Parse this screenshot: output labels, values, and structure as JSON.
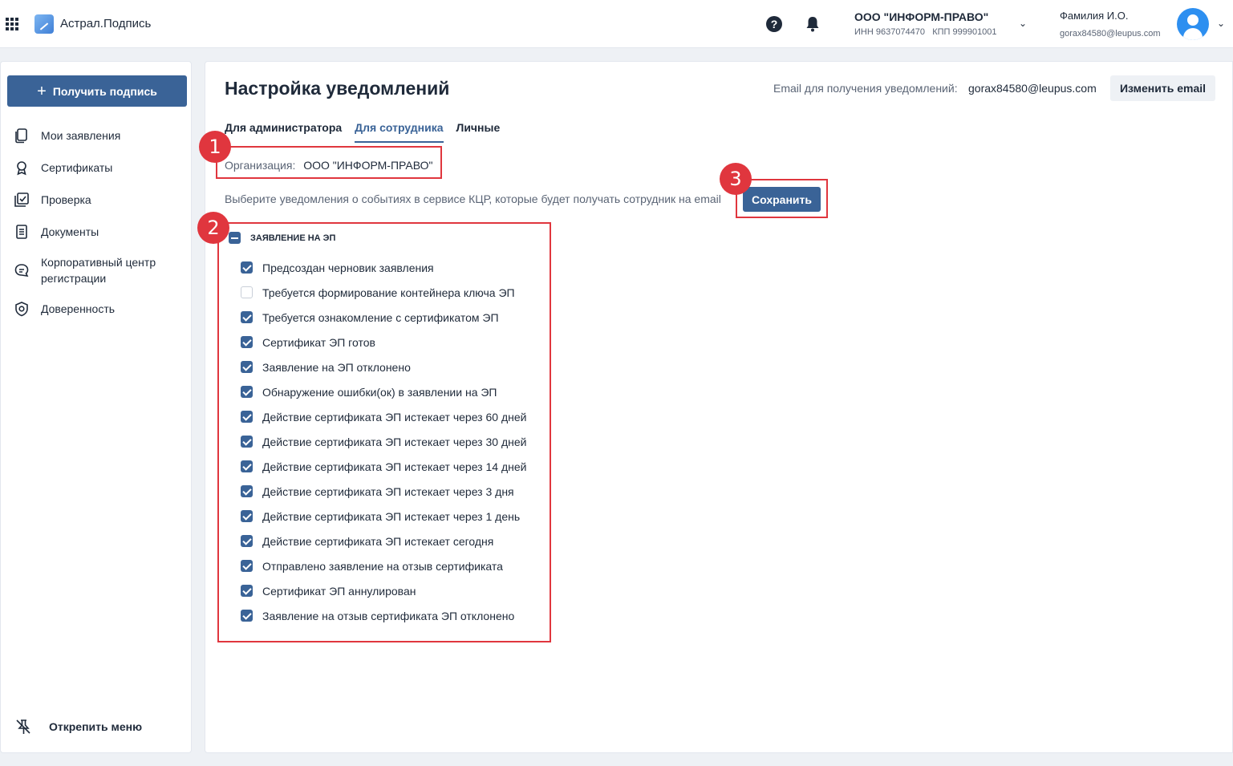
{
  "header": {
    "app_title": "Астрал.Подпись",
    "org_name": "ООО \"ИНФОРМ-ПРАВО\"",
    "org_inn": "ИНН 9637074470",
    "org_kpp": "КПП 999901001",
    "user_name": "Фамилия И.О.",
    "user_email": "gorax84580@leupus.com",
    "icons": [
      "apps-grid-icon",
      "help-icon",
      "bell-icon",
      "chevron-down-icon",
      "avatar-icon"
    ]
  },
  "sidebar": {
    "get_sign_label": "Получить подпись",
    "items": [
      {
        "label": "Мои заявления",
        "icon": "documents-icon"
      },
      {
        "label": "Сертификаты",
        "icon": "certificate-icon"
      },
      {
        "label": "Проверка",
        "icon": "check-icon"
      },
      {
        "label": "Документы",
        "icon": "document-icon"
      },
      {
        "label": "Корпоративный центр регистрации",
        "icon": "chat-icon"
      },
      {
        "label": "Доверенность",
        "icon": "shield-icon"
      }
    ],
    "unpin_label": "Открепить меню"
  },
  "main": {
    "title": "Настройка уведомлений",
    "email_label": "Email для получения уведомлений:",
    "email_value": "gorax84580@leupus.com",
    "change_email_label": "Изменить email",
    "tabs": [
      {
        "label": "Для администратора",
        "active": false
      },
      {
        "label": "Для сотрудника",
        "active": true
      },
      {
        "label": "Личные",
        "active": false
      }
    ],
    "org_label": "Организация:",
    "org_value": "ООО \"ИНФОРМ-ПРАВО\"",
    "description": "Выберите уведомления о событиях в сервисе КЦР, которые будет получать сотрудник на email",
    "save_label": "Сохранить",
    "group_title": "ЗАЯВЛЕНИЕ НА ЭП",
    "notifications": [
      {
        "label": "Предсоздан черновик заявления",
        "checked": true
      },
      {
        "label": "Требуется формирование контейнера ключа ЭП",
        "checked": false
      },
      {
        "label": "Требуется ознакомление с сертификатом ЭП",
        "checked": true
      },
      {
        "label": "Сертификат ЭП готов",
        "checked": true
      },
      {
        "label": "Заявление на ЭП отклонено",
        "checked": true
      },
      {
        "label": "Обнаружение ошибки(ок) в заявлении на ЭП",
        "checked": true
      },
      {
        "label": "Действие сертификата ЭП истекает через 60 дней",
        "checked": true
      },
      {
        "label": "Действие сертификата ЭП истекает через 30 дней",
        "checked": true
      },
      {
        "label": "Действие сертификата ЭП истекает через 14 дней",
        "checked": true
      },
      {
        "label": "Действие сертификата ЭП истекает через 3 дня",
        "checked": true
      },
      {
        "label": "Действие сертификата ЭП истекает через 1 день",
        "checked": true
      },
      {
        "label": "Действие сертификата ЭП истекает сегодня",
        "checked": true
      },
      {
        "label": "Отправлено заявление на отзыв сертификата",
        "checked": true
      },
      {
        "label": "Сертификат ЭП аннулирован",
        "checked": true
      },
      {
        "label": "Заявление на отзыв сертификата ЭП отклонено",
        "checked": true
      }
    ]
  },
  "annotations": [
    "1",
    "2",
    "3"
  ],
  "colors": {
    "accent": "#3a6397",
    "annotation": "#e0363e",
    "avatar": "#2d8ff0"
  }
}
